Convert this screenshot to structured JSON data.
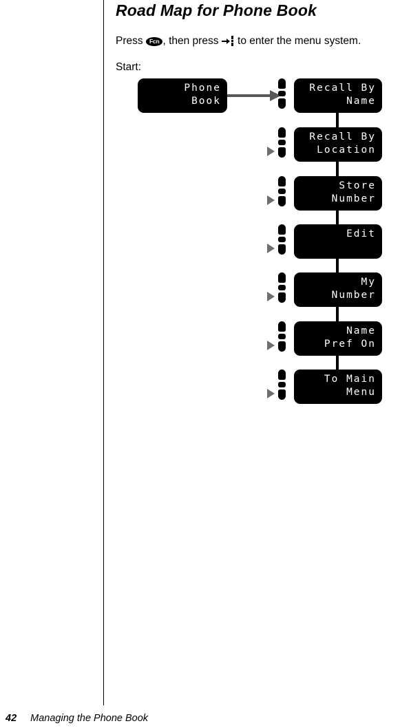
{
  "page": {
    "title": "Road Map for Phone Book",
    "intro_prefix": "Press ",
    "intro_key_label": "Fcn",
    "intro_middle": ", then press ",
    "intro_suffix": " to enter the menu system.",
    "start_label": "Start:",
    "colors": {
      "lcd_background": "#000000",
      "lcd_text": "#ffffff",
      "flow_arrow": "#575757",
      "scroll_triangle": "#6e6e6e",
      "connector": "#000000",
      "rule": "#000000"
    }
  },
  "diagram": {
    "start_node": {
      "line1": "Phone",
      "line2": "Book"
    },
    "menu_items": [
      {
        "line1": "Recall By",
        "line2": "Name",
        "has_triangle": false
      },
      {
        "line1": "Recall By",
        "line2": "Location",
        "has_triangle": true
      },
      {
        "line1": "Store",
        "line2": "Number",
        "has_triangle": true
      },
      {
        "line1": "Edit",
        "line2": "",
        "has_triangle": true
      },
      {
        "line1": "My",
        "line2": "Number",
        "has_triangle": true
      },
      {
        "line1": "Name",
        "line2": "Pref On",
        "has_triangle": true
      },
      {
        "line1": "To Main",
        "line2": "Menu",
        "has_triangle": true
      }
    ]
  },
  "footer": {
    "page_number": "42",
    "section_title": "Managing the Phone Book"
  }
}
